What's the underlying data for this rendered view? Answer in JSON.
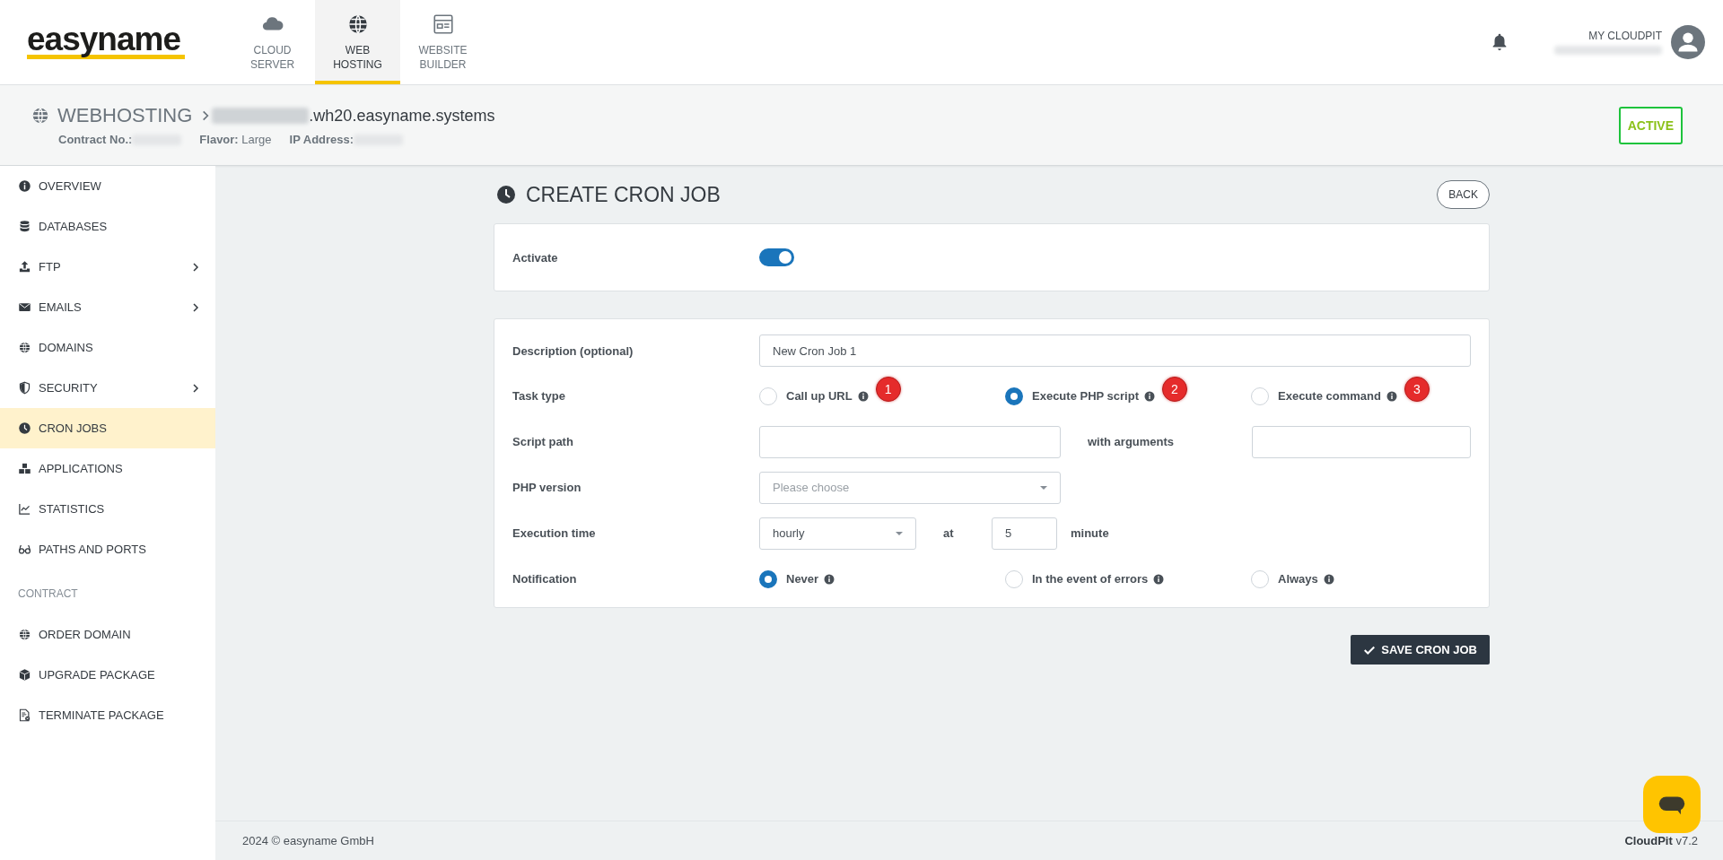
{
  "header": {
    "logo": "easyname",
    "nav": [
      {
        "label": "CLOUD SERVER",
        "kind": "cloud",
        "selected": false
      },
      {
        "label": "WEB HOSTING",
        "kind": "globe",
        "selected": true
      },
      {
        "label": "WEBSITE BUILDER",
        "kind": "layout",
        "selected": false
      }
    ],
    "account": {
      "label": "MY CLOUDPIT"
    }
  },
  "subheader": {
    "section": "WEBHOSTING",
    "host": ".wh20.easyname.systems",
    "meta": [
      {
        "label": "Contract No.:"
      },
      {
        "label": "Flavor:",
        "value": "Large"
      },
      {
        "label": "IP Address:"
      }
    ],
    "status": "ACTIVE"
  },
  "sidebar": {
    "groups": [
      {
        "items": [
          {
            "label": "OVERVIEW",
            "kind": "info",
            "submenu": false,
            "selected": false
          },
          {
            "label": "DATABASES",
            "kind": "database",
            "submenu": false,
            "selected": false
          },
          {
            "label": "FTP",
            "kind": "upload",
            "submenu": true,
            "selected": false
          },
          {
            "label": "EMAILS",
            "kind": "envelope",
            "submenu": true,
            "selected": false
          },
          {
            "label": "DOMAINS",
            "kind": "globe",
            "submenu": false,
            "selected": false
          },
          {
            "label": "SECURITY",
            "kind": "shield",
            "submenu": true,
            "selected": false
          },
          {
            "label": "CRON JOBS",
            "kind": "clock",
            "submenu": false,
            "selected": true
          },
          {
            "label": "APPLICATIONS",
            "kind": "boxes",
            "submenu": false,
            "selected": false
          },
          {
            "label": "STATISTICS",
            "kind": "chart",
            "submenu": false,
            "selected": false
          },
          {
            "label": "PATHS AND PORTS",
            "kind": "glasses",
            "submenu": false,
            "selected": false
          }
        ]
      },
      {
        "heading": "CONTRACT",
        "items": [
          {
            "label": "ORDER DOMAIN",
            "kind": "globe",
            "submenu": false,
            "selected": false
          },
          {
            "label": "UPGRADE PACKAGE",
            "kind": "cube",
            "submenu": false,
            "selected": false
          },
          {
            "label": "TERMINATE PACKAGE",
            "kind": "document",
            "submenu": false,
            "selected": false
          }
        ]
      }
    ]
  },
  "page": {
    "title": "CREATE CRON JOB",
    "back": "BACK"
  },
  "activate": {
    "label": "Activate",
    "on": true
  },
  "form": {
    "description": {
      "label": "Description (optional)",
      "value": "New Cron Job 1"
    },
    "task_type": {
      "label": "Task type",
      "options": [
        {
          "label": "Call up URL",
          "badge": "1",
          "selected": false
        },
        {
          "label": "Execute PHP script",
          "badge": "2",
          "selected": true
        },
        {
          "label": "Execute command",
          "badge": "3",
          "selected": false
        }
      ]
    },
    "script_path": {
      "label": "Script path",
      "arguments_label": "with arguments"
    },
    "php_version": {
      "label": "PHP version",
      "placeholder": "Please choose"
    },
    "execution_time": {
      "label": "Execution time",
      "value": "hourly",
      "at": "at",
      "minute": "5",
      "unit": "minute"
    },
    "notification": {
      "label": "Notification",
      "options": [
        {
          "label": "Never",
          "selected": true
        },
        {
          "label": "In the event of errors",
          "selected": false
        },
        {
          "label": "Always",
          "selected": false
        }
      ]
    }
  },
  "save": "SAVE CRON JOB",
  "footer": {
    "copyright": "2024 © easyname GmbH",
    "brand": "CloudPit",
    "version": "v7.2"
  }
}
